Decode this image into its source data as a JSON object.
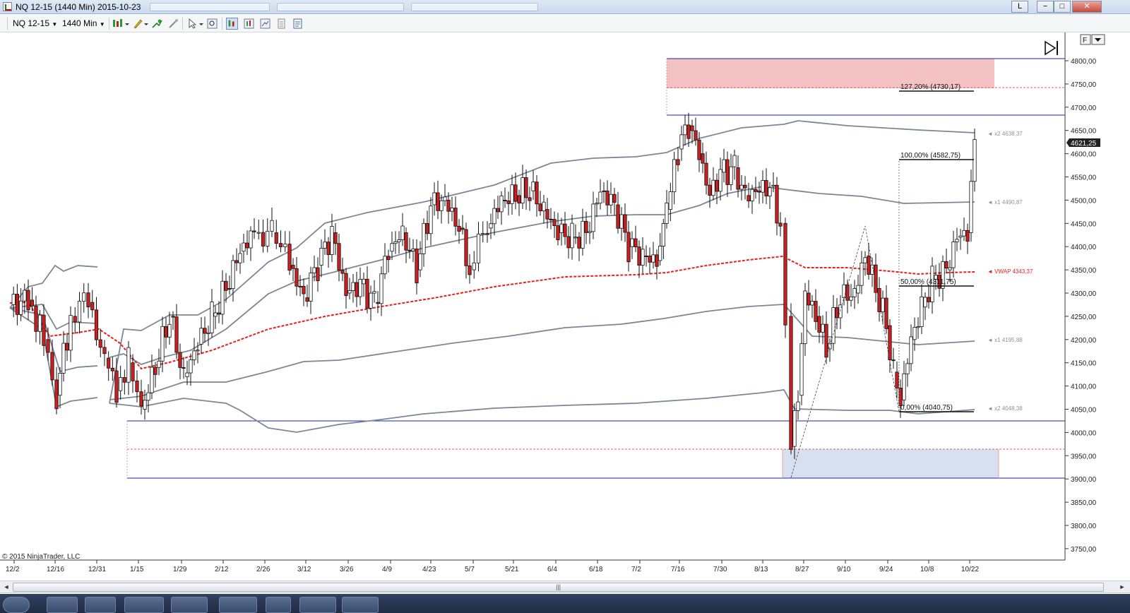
{
  "window": {
    "title": "NQ 12-15 (1440 Min)  2015-10-23",
    "button_l": "L",
    "button_min": "−",
    "button_max": "□",
    "button_close": "✕"
  },
  "toolbar": {
    "instrument": "NQ 12-15",
    "interval": "1440 Min",
    "icons": [
      "candlestick-style-icon",
      "pencil-draw-icon",
      "add-indicator-icon",
      "properties-icon",
      "cursor-icon",
      "zoom-icon",
      "price-marker-icon",
      "bar-marker-icon",
      "chart-trader-icon",
      "data-box-icon",
      "strategy-icon"
    ]
  },
  "chart": {
    "copyright": "© 2015 NinjaTrader, LLC",
    "panel_button": "F",
    "last_price": "4621,25",
    "price_ticks": [
      "4800,00",
      "4750,00",
      "4700,00",
      "4650,00",
      "4600,00",
      "4550,00",
      "4500,00",
      "4450,00",
      "4400,00",
      "4350,00",
      "4300,00",
      "4250,00",
      "4200,00",
      "4150,00",
      "4100,00",
      "4050,00",
      "4000,00",
      "3950,00",
      "3900,00",
      "3850,00",
      "3800,00",
      "3750,00"
    ],
    "date_ticks": [
      "12/2",
      "12/16",
      "12/31",
      "1/15",
      "1/29",
      "2/12",
      "2/26",
      "3/12",
      "3/26",
      "4/9",
      "4/23",
      "5/7",
      "5/21",
      "6/4",
      "6/18",
      "7/2",
      "7/16",
      "7/30",
      "8/13",
      "8/27",
      "9/10",
      "9/24",
      "10/8",
      "10/22"
    ],
    "fib_labels": {
      "f127": "127,20% (4730,17)",
      "f100": "100,00% (4582,75)",
      "f50": "50,00% (4311,75)",
      "f0": "0,00% (4040,75)"
    },
    "band_labels": {
      "upper2": "◄ x2  4638,37",
      "upper1": "◄ x1  4490,87",
      "vwap": "◄  VWAP  4343,37",
      "lower1": "◄ x1  4195,88",
      "lower2": "◄ x2  4048,38"
    },
    "colors": {
      "up_candle": "#ffffff",
      "down_candle": "#cc1f1f",
      "vwap": "#e8201f",
      "bands": "#7c8696",
      "zone_lines": "#1c22b0",
      "zone_fill_top": "#f5c2c4",
      "zone_fill_bottom": "#d7e0ee"
    }
  },
  "chart_data": {
    "type": "candlestick",
    "y_range": [
      3725,
      4825
    ],
    "series": [
      {
        "name": "VWAP",
        "last": 4343.37
      },
      {
        "name": "x2",
        "last": 4638.37
      },
      {
        "name": "x1",
        "last": 4490.87
      },
      {
        "name": "x1",
        "last": 4195.88
      },
      {
        "name": "x2",
        "last": 4048.38
      }
    ],
    "fibonacci": [
      {
        "level": "127,20%",
        "price": 4730.17
      },
      {
        "level": "100,00%",
        "price": 4582.75
      },
      {
        "level": "50,00%",
        "price": 4311.75
      },
      {
        "level": "0,00%",
        "price": 4040.75
      }
    ],
    "last_close": 4621.25
  }
}
